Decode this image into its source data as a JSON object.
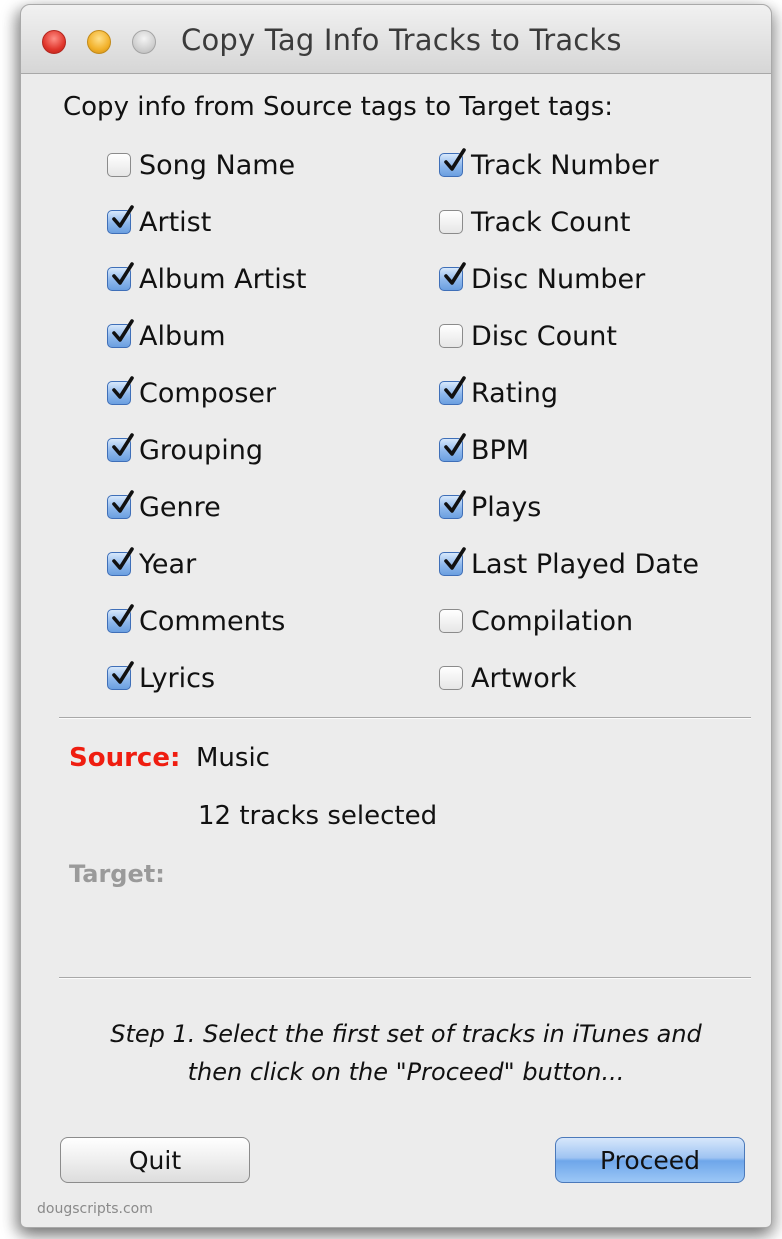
{
  "window": {
    "title": "Copy Tag Info Tracks to Tracks"
  },
  "heading": "Copy info from Source tags to Target tags:",
  "left_column": [
    {
      "label": "Song Name",
      "checked": false
    },
    {
      "label": "Artist",
      "checked": true
    },
    {
      "label": "Album Artist",
      "checked": true
    },
    {
      "label": "Album",
      "checked": true
    },
    {
      "label": "Composer",
      "checked": true
    },
    {
      "label": "Grouping",
      "checked": true
    },
    {
      "label": "Genre",
      "checked": true
    },
    {
      "label": "Year",
      "checked": true
    },
    {
      "label": "Comments",
      "checked": true
    },
    {
      "label": "Lyrics",
      "checked": true
    }
  ],
  "right_column": [
    {
      "label": "Track Number",
      "checked": true
    },
    {
      "label": "Track Count",
      "checked": false
    },
    {
      "label": "Disc Number",
      "checked": true
    },
    {
      "label": "Disc Count",
      "checked": false
    },
    {
      "label": "Rating",
      "checked": true
    },
    {
      "label": "BPM",
      "checked": true
    },
    {
      "label": "Plays",
      "checked": true
    },
    {
      "label": "Last Played Date",
      "checked": true
    },
    {
      "label": "Compilation",
      "checked": false
    },
    {
      "label": "Artwork",
      "checked": false
    }
  ],
  "source": {
    "label": "Source:",
    "value": "Music",
    "count": "12 tracks selected"
  },
  "target": {
    "label": "Target:"
  },
  "instructions": {
    "line1": "Step 1. Select the first set of tracks in iTunes and",
    "line2": "then click on the \"Proceed\" button..."
  },
  "buttons": {
    "quit": "Quit",
    "proceed": "Proceed"
  },
  "footer": "dougscripts.com",
  "colors": {
    "source_label": "#ef1d10",
    "target_label": "#9a9a9a",
    "default_button": "#6ea6ea"
  }
}
